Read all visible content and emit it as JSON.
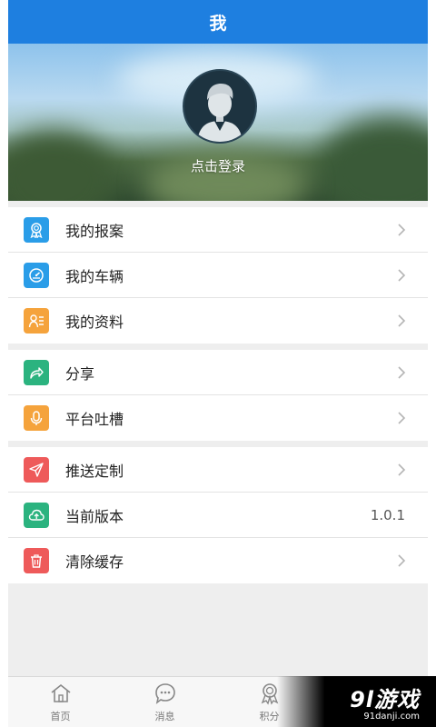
{
  "header": {
    "title": "我"
  },
  "profile": {
    "login_text": "点击登录"
  },
  "menu_groups": [
    [
      {
        "label": "我的报案",
        "icon": "award-icon",
        "color": "#2a9de8",
        "has_arrow": true
      },
      {
        "label": "我的车辆",
        "icon": "speedometer-icon",
        "color": "#2a9de8",
        "has_arrow": true
      },
      {
        "label": "我的资料",
        "icon": "profile-card-icon",
        "color": "#f5a33c",
        "has_arrow": true
      }
    ],
    [
      {
        "label": "分享",
        "icon": "share-icon",
        "color": "#2bb37f",
        "has_arrow": true
      },
      {
        "label": "平台吐槽",
        "icon": "microphone-icon",
        "color": "#f5a33c",
        "has_arrow": true
      }
    ],
    [
      {
        "label": "推送定制",
        "icon": "send-icon",
        "color": "#ee5a5a",
        "has_arrow": true
      },
      {
        "label": "当前版本",
        "icon": "cloud-upload-icon",
        "color": "#2bb37f",
        "value": "1.0.1"
      },
      {
        "label": "清除缓存",
        "icon": "trash-icon",
        "color": "#ee5a5a",
        "has_arrow": true
      }
    ]
  ],
  "tabs": [
    {
      "label": "首页",
      "icon": "home-icon"
    },
    {
      "label": "消息",
      "icon": "chat-icon"
    },
    {
      "label": "积分",
      "icon": "medal-icon"
    }
  ],
  "watermark": {
    "main": "9l游戏",
    "sub": "91danji.com"
  }
}
